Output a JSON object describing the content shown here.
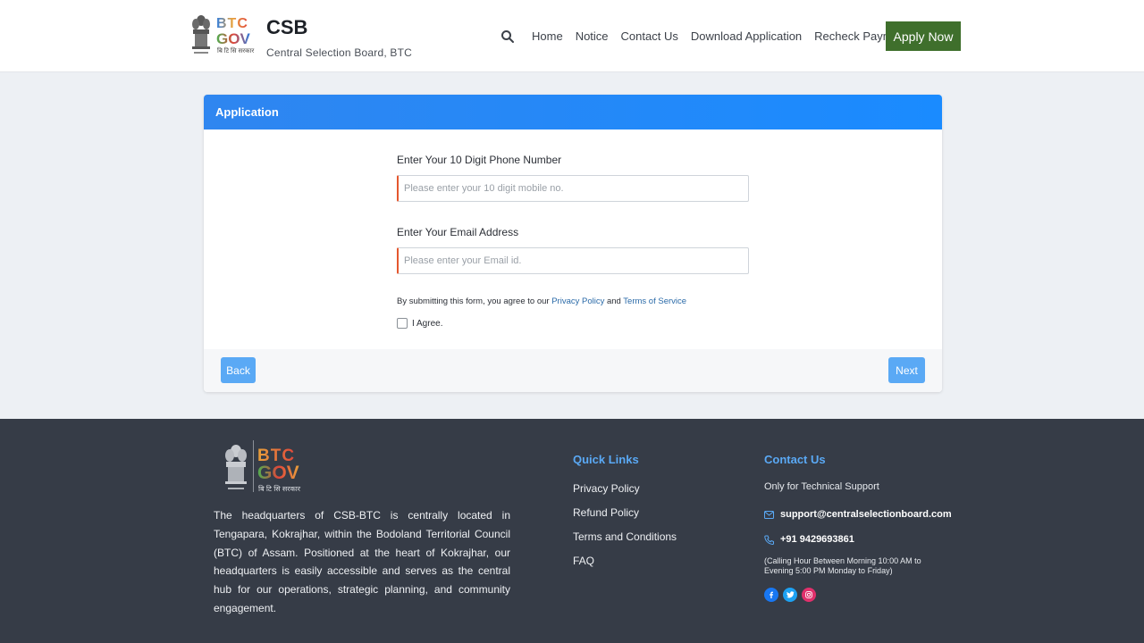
{
  "header": {
    "logo_top": "BTC",
    "logo_bottom": "GOV",
    "logo_sub": "बि टि सि सरकार",
    "title": "CSB",
    "subtitle": "Central Selection Board, BTC",
    "nav": [
      "Home",
      "Notice",
      "Contact Us",
      "Download Application",
      "Recheck Payment"
    ],
    "apply_label": "Apply Now"
  },
  "card": {
    "title": "Application",
    "phone_label": "Enter Your 10 Digit Phone Number",
    "phone_placeholder": "Please enter your 10 digit mobile no.",
    "email_label": "Enter Your Email Address",
    "email_placeholder": "Please enter your Email id.",
    "agree_prefix": "By submitting this form, you agree to our",
    "privacy_link": "Privacy Policy",
    "agree_and": "and",
    "terms_link": "Terms of Service",
    "agree_label": "I Agree.",
    "back_label": "Back",
    "next_label": "Next"
  },
  "footer": {
    "logo_top": "BTC",
    "logo_bottom": "GOV",
    "logo_sub": "बि टि सि सरकार",
    "about": "The headquarters of CSB-BTC is centrally located in Tengapara, Kokrajhar, within the Bodoland Territorial Council (BTC) of Assam. Positioned at the heart of Kokrajhar, our headquarters is easily accessible and serves as the central hub for our operations, strategic planning, and community engagement.",
    "quick_links_title": "Quick Links",
    "quick_links": [
      "Privacy Policy",
      "Refund Policy",
      "Terms and Conditions",
      "FAQ"
    ],
    "contact_title": "Contact Us",
    "contact_note": "Only for Technical Support",
    "email": "support@centralselectionboard.com",
    "phone": "+91 9429693861",
    "hours": "(Calling Hour Between Morning 10:00 AM to Evening 5:00 PM Monday to Friday)"
  },
  "colors": {
    "accent_blue": "#1a8bff",
    "apply_green": "#3f6f2c",
    "footer_bg": "#363c47",
    "input_accent": "#e4572e"
  },
  "icons": [
    "emblem-icon",
    "search-icon",
    "mail-icon",
    "phone-icon",
    "facebook-icon",
    "twitter-icon",
    "instagram-icon"
  ]
}
